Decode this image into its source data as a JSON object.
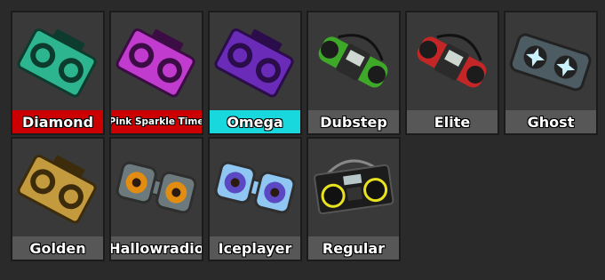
{
  "inventory": {
    "items": [
      {
        "name": "Diamond",
        "label_bg": "#cc0000",
        "color": "#2db58f",
        "accent": "#0d3b2e",
        "shape": "boombox"
      },
      {
        "name": "Pink Sparkle Time",
        "label_bg": "#cc0000",
        "color": "#c23bcf",
        "accent": "#3c0d44",
        "shape": "boombox",
        "small": true
      },
      {
        "name": "Omega",
        "label_bg": "#18d8dd",
        "color": "#6a2bb8",
        "accent": "#2a0d4a",
        "shape": "boombox"
      },
      {
        "name": "Dubstep",
        "label_bg": "#575757",
        "color": "#3ea829",
        "accent": "#1c1c1c",
        "shape": "capsule"
      },
      {
        "name": "Elite",
        "label_bg": "#575757",
        "color": "#c22626",
        "accent": "#1c1c1c",
        "shape": "capsule"
      },
      {
        "name": "Ghost",
        "label_bg": "#575757",
        "color": "#4d5c63",
        "accent": "#c9f4ff",
        "shape": "ghost"
      },
      {
        "name": "Golden",
        "label_bg": "#575757",
        "color": "#c39a3e",
        "accent": "#3d2c0c",
        "shape": "boombox"
      },
      {
        "name": "Hallowradio",
        "label_bg": "#575757",
        "color": "#6c7a7d",
        "accent": "#e28d12",
        "shape": "twin"
      },
      {
        "name": "Iceplayer",
        "label_bg": "#575757",
        "color": "#8fc7f2",
        "accent": "#5b49c4",
        "shape": "twin"
      },
      {
        "name": "Regular",
        "label_bg": "#575757",
        "color": "#1c1c1c",
        "accent": "#e8e21f",
        "shape": "regular"
      }
    ]
  }
}
